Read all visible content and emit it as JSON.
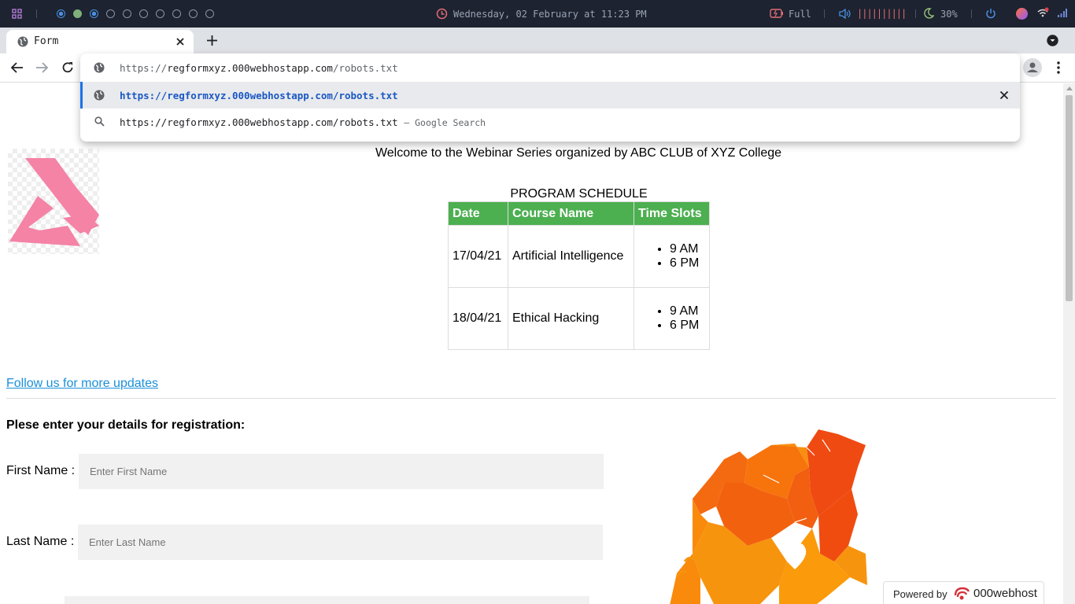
{
  "sysbar": {
    "datetime": "Wednesday, 02 February at 11:23 PM",
    "battery": "Full",
    "volume_bars": "||||||||||",
    "brightness": "30%"
  },
  "browser": {
    "tab_title": "Form",
    "url_prefix": "https://",
    "url_host": "regformxyz.000webhostapp.com",
    "url_path": "/robots.txt",
    "suggestion_url": "https://regformxyz.000webhostapp.com/robots.txt",
    "search_query": "https://regformxyz.000webhostapp.com/robots.txt",
    "search_suffix": "– Google Search"
  },
  "page": {
    "welcome": "Welcome to the Webinar Series organized by ABC CLUB of XYZ College",
    "schedule_title": "PROGRAM SCHEDULE",
    "table": {
      "headers": [
        "Date",
        "Course Name",
        "Time Slots"
      ],
      "rows": [
        {
          "date": "17/04/21",
          "course": "Artificial Intelligence",
          "slots": [
            "9 AM",
            "6 PM"
          ]
        },
        {
          "date": "18/04/21",
          "course": "Ethical Hacking",
          "slots": [
            "9 AM",
            "6 PM"
          ]
        }
      ]
    },
    "follow_link": "Follow us for more updates",
    "reg_heading": "Plese enter your details for registration:",
    "first_name_label": "First Name :",
    "first_name_placeholder": "Enter First Name",
    "last_name_label": "Last Name :",
    "last_name_placeholder": "Enter Last Name",
    "powered_by": "Powered by",
    "host_brand": "000webhost"
  },
  "colors": {
    "table_header": "#4caf50",
    "link": "#1a73e8",
    "sysbar_bg": "#1d2330"
  }
}
